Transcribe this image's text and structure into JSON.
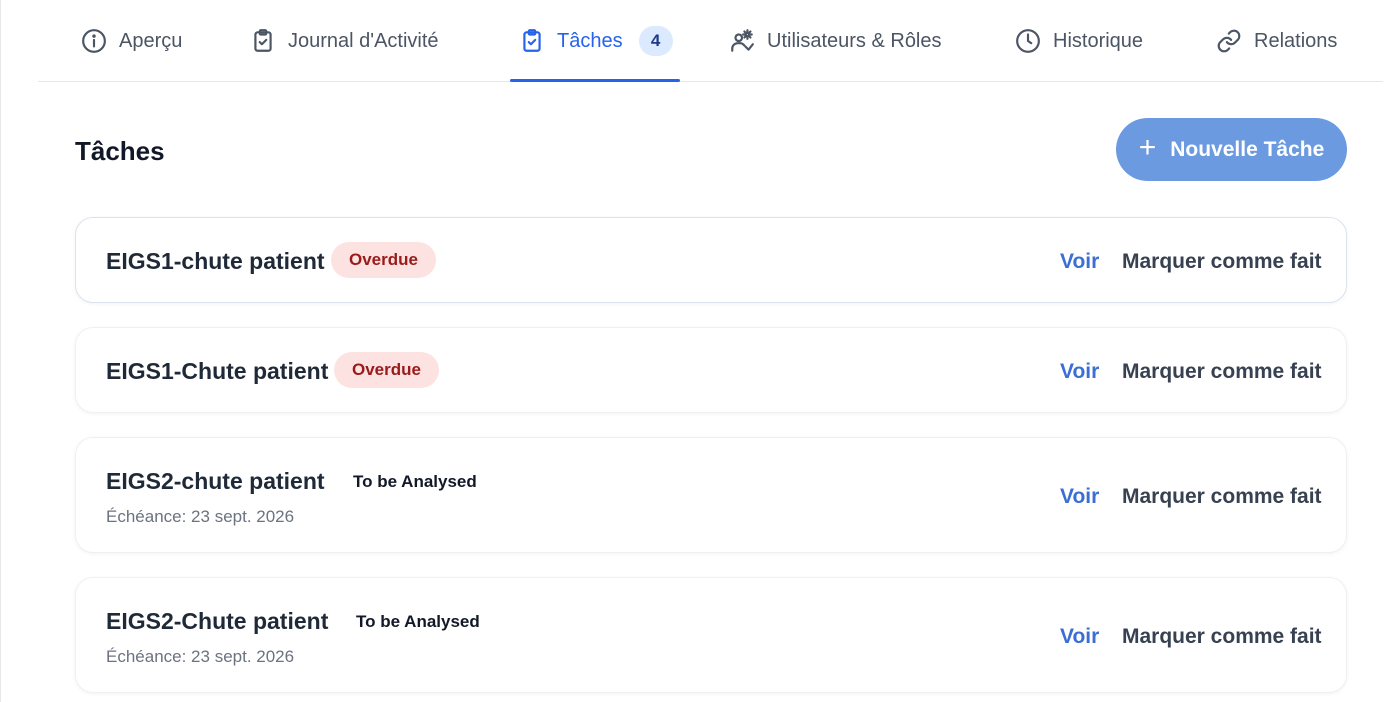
{
  "tabs": [
    {
      "label": "Aperçu",
      "icon": "info-icon"
    },
    {
      "label": "Journal d'Activité",
      "icon": "clipboard-icon"
    },
    {
      "label": "Tâches",
      "icon": "clipboard-check-icon",
      "count": "4",
      "active": true
    },
    {
      "label": "Utilisateurs & Rôles",
      "icon": "users-cog-icon"
    },
    {
      "label": "Historique",
      "icon": "clock-icon"
    },
    {
      "label": "Relations",
      "icon": "link-icon"
    }
  ],
  "section": {
    "title": "Tâches",
    "new_button_label": "Nouvelle Tâche"
  },
  "tasks": [
    {
      "title": "EIGS1-chute patient",
      "status": "Overdue",
      "status_style": "overdue",
      "due": "",
      "view_label": "Voir",
      "done_label": "Marquer comme fait"
    },
    {
      "title": "EIGS1-Chute patient",
      "status": "Overdue",
      "status_style": "overdue",
      "due": "",
      "view_label": "Voir",
      "done_label": "Marquer comme fait"
    },
    {
      "title": "EIGS2-chute patient",
      "status": "To be Analysed",
      "status_style": "plain",
      "due": "Échéance: 23 sept. 2026",
      "view_label": "Voir",
      "done_label": "Marquer comme fait"
    },
    {
      "title": "EIGS2-Chute patient",
      "status": "To be Analysed",
      "status_style": "plain",
      "due": "Échéance: 23 sept. 2026",
      "view_label": "Voir",
      "done_label": "Marquer comme fait"
    }
  ],
  "colors": {
    "accent": "#2563eb",
    "button": "#6b9ae0",
    "overdue_bg": "#fde2e2",
    "overdue_text": "#991b1b"
  }
}
